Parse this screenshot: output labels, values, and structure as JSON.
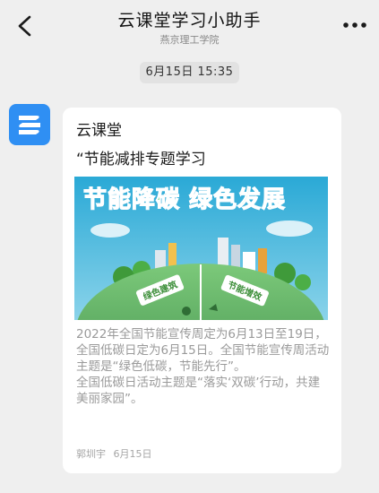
{
  "header": {
    "title": "云课堂学习小助手",
    "subtitle": "燕京理工学院"
  },
  "timestamp": "6月15日 15:35",
  "message": {
    "source": "云课堂",
    "title": "“节能减排专题学习",
    "image": {
      "banner_text": "节能降碳  绿色发展",
      "left_sign": "绿色建筑",
      "right_sign": "节能增效"
    },
    "description": [
      "2022年全国节能宣传周定为6月13日至19日，全国低碳日定为6月15日。全国节能宣传周活动主题是“绿色低碳，节能先行”。",
      "全国低碳日活动主题是“落实‘双碳’行动，共建美丽家园”。"
    ],
    "author": "郭圳宇",
    "date": "6月15日"
  },
  "colors": {
    "background": "#efefef",
    "card": "#ffffff",
    "avatar": "#2f8ff3",
    "banner_green": "#3fb34f"
  }
}
